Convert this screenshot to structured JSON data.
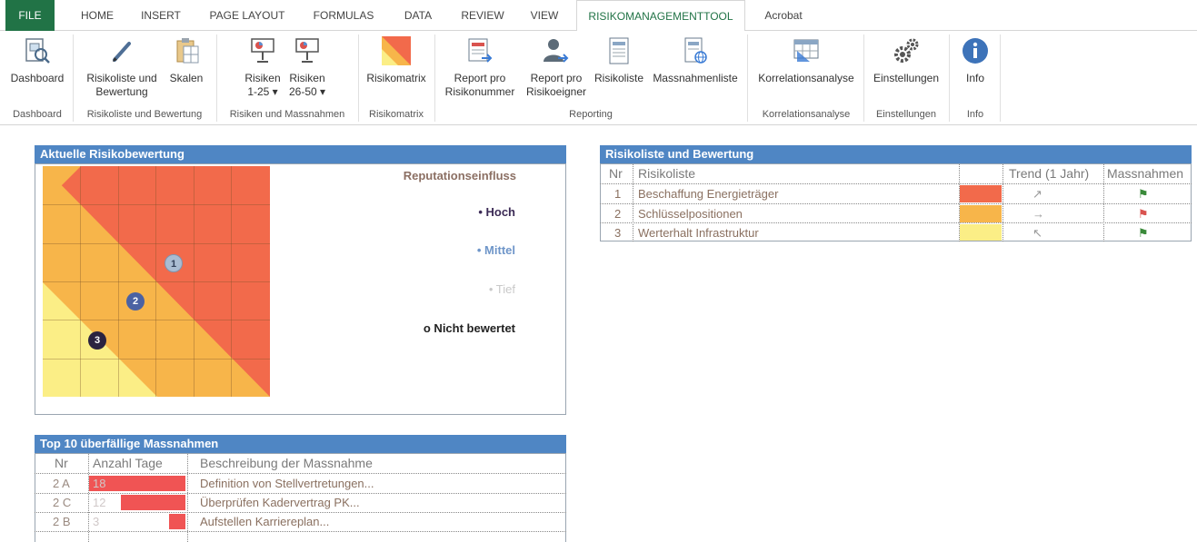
{
  "ribbon": {
    "tabs": [
      {
        "label": "FILE"
      },
      {
        "label": "HOME"
      },
      {
        "label": "INSERT"
      },
      {
        "label": "PAGE LAYOUT"
      },
      {
        "label": "FORMULAS"
      },
      {
        "label": "DATA"
      },
      {
        "label": "REVIEW"
      },
      {
        "label": "VIEW"
      },
      {
        "label": "RISIKOMANAGEMENTTOOL"
      },
      {
        "label": "Acrobat"
      }
    ],
    "buttons": {
      "dashboard": "Dashboard",
      "risikoliste_l1": "Risikoliste und",
      "risikoliste_l2": "Bewertung",
      "skalen": "Skalen",
      "risiken1_l1": "Risiken",
      "risiken1_l2": "1-25 ▾",
      "risiken2_l1": "Risiken",
      "risiken2_l2": "26-50 ▾",
      "risikomatrix": "Risikomatrix",
      "report_nr_l1": "Report pro",
      "report_nr_l2": "Risikonummer",
      "report_eig_l1": "Report pro",
      "report_eig_l2": "Risikoeigner",
      "risikoliste": "Risikoliste",
      "massnahmenliste": "Massnahmenliste",
      "korrelation": "Korrelationsanalyse",
      "einstellungen": "Einstellungen",
      "info": "Info"
    },
    "groups": {
      "dashboard": "Dashboard",
      "risikoliste": "Risikoliste und Bewertung",
      "risiken": "Risiken und Massnahmen",
      "risikomatrix": "Risikomatrix",
      "reporting": "Reporting",
      "korrelation": "Korrelationsanalyse",
      "einstellungen": "Einstellungen",
      "info": "Info"
    }
  },
  "risk_panel": {
    "title": "Aktuelle Risikobewertung",
    "legend_title": "Reputationseinfluss",
    "legend": {
      "hoch": "• Hoch",
      "mittel": "• Mittel",
      "tief": "• Tief",
      "nicht": "o Nicht bewertet"
    },
    "markers": [
      "1",
      "2",
      "3"
    ]
  },
  "risk_list": {
    "title": "Risikoliste und Bewertung",
    "headers": {
      "nr": "Nr",
      "name": "Risikoliste",
      "trend": "Trend (1 Jahr)",
      "massnahmen": "Massnahmen"
    },
    "rows": [
      {
        "nr": "1",
        "name": "Beschaffung Energieträger",
        "color": "#f26a4b",
        "trend": "↗"
      },
      {
        "nr": "2",
        "name": "Schlüsselpositionen",
        "color": "#f7b54a",
        "trend": "→"
      },
      {
        "nr": "3",
        "name": "Werterhalt Infrastruktur",
        "color": "#fbee86",
        "trend": "↖"
      }
    ]
  },
  "overdue": {
    "title": "Top 10 überfällige Massnahmen",
    "headers": {
      "nr": "Nr",
      "days": "Anzahl Tage",
      "desc": "Beschreibung der Massnahme"
    },
    "rows": [
      {
        "nr": "2 A",
        "days": "18",
        "days_value": 18,
        "desc": "Definition von Stellvertretungen..."
      },
      {
        "nr": "2 C",
        "days": "12",
        "days_value": 12,
        "desc": "Überprüfen Kadervertrag PK..."
      },
      {
        "nr": "2 B",
        "days": "3",
        "days_value": 3,
        "desc": "Aufstellen Karriereplan..."
      }
    ]
  }
}
